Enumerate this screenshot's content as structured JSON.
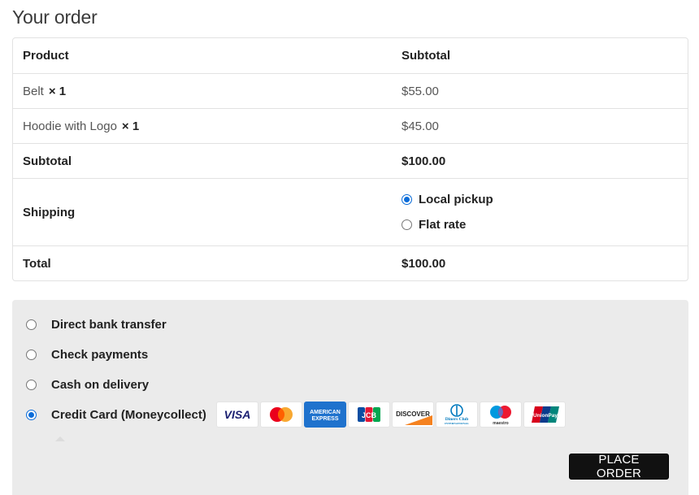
{
  "page": {
    "title": "Your order"
  },
  "table": {
    "header": {
      "product": "Product",
      "subtotal": "Subtotal"
    },
    "items": [
      {
        "name": "Belt",
        "qty": "× 1",
        "price": "$55.00"
      },
      {
        "name": "Hoodie with Logo",
        "qty": "× 1",
        "price": "$45.00"
      }
    ],
    "subtotal": {
      "label": "Subtotal",
      "value": "$100.00"
    },
    "shipping": {
      "label": "Shipping",
      "options": [
        {
          "label": "Local pickup",
          "checked": true
        },
        {
          "label": "Flat rate",
          "checked": false
        }
      ]
    },
    "total": {
      "label": "Total",
      "value": "$100.00"
    }
  },
  "payment": {
    "methods": [
      {
        "label": "Direct bank transfer",
        "checked": false
      },
      {
        "label": "Check payments",
        "checked": false
      },
      {
        "label": "Cash on delivery",
        "checked": false
      },
      {
        "label": "Credit Card (Moneycollect)",
        "checked": true
      }
    ],
    "card_brands": {
      "visa": "VISA",
      "amex_line1": "AMERICAN",
      "amex_line2": "EXPRESS",
      "jcb": "JCB",
      "discover": "DISCOVER",
      "diners_line1": "Diners Club",
      "diners_line2": "INTERNATIONAL",
      "maestro": "maestro",
      "unionpay": "UnionPay"
    },
    "place_order_label": "PLACE ORDER"
  },
  "colors": {
    "radio_checked": "#0a6cd9",
    "panel_bg": "#ebebeb",
    "button_bg": "#111111"
  }
}
